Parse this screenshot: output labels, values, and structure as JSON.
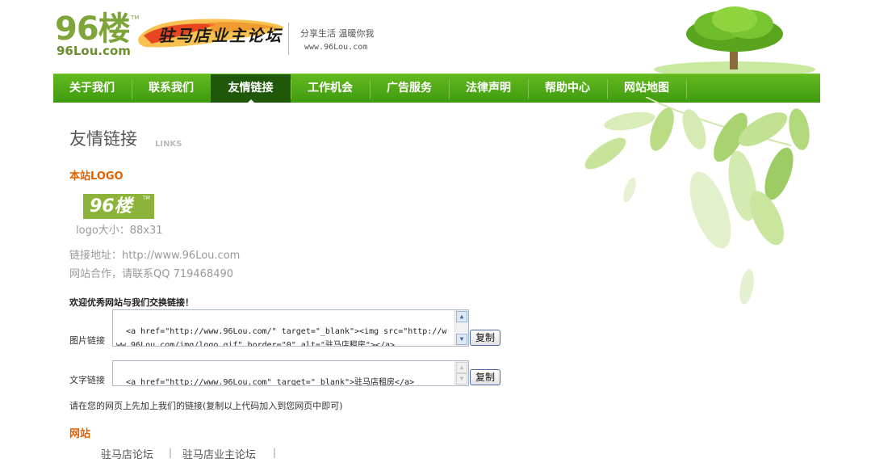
{
  "header": {
    "logo_main": "96楼",
    "logo_tm": "TM",
    "logo_domain": "96Lou.com",
    "banner_text": "驻马店业主论坛",
    "slogan": "分享生活 温暖你我",
    "url": "www.96Lou.com"
  },
  "nav": {
    "items": [
      {
        "label": "关于我们"
      },
      {
        "label": "联系我们"
      },
      {
        "label": "友情链接",
        "active": true
      },
      {
        "label": "工作机会"
      },
      {
        "label": "广告服务"
      },
      {
        "label": "法律声明"
      },
      {
        "label": "帮助中心"
      },
      {
        "label": "网站地图"
      }
    ]
  },
  "page": {
    "title": "友情链接",
    "subtitle": "LINKS"
  },
  "logo_section": {
    "heading": "本站LOGO",
    "logo_text": "96楼",
    "logo_tm": "TM",
    "logo_size": "logo大小：88x31",
    "link_address": "链接地址：http://www.96Lou.com",
    "contact": "网站合作，请联系QQ 719468490"
  },
  "exchange": {
    "heading": "欢迎优秀网站与我们交换链接！",
    "image_link_label": "图片链接",
    "image_link_code": "<a href=\"http://www.96Lou.com/\" target=\"_blank\"><img src=\"http://www.96Lou.com/img/logo.gif\" border=\"0\" alt=\"驻马店租房\"></a>",
    "text_link_label": "文字链接",
    "text_link_code": "<a href=\"http://www.96Lou.com\" target=\"_blank\">驻马店租房</a>",
    "copy_label": "复制",
    "note": "请在您的网页上先加上我们的链接(复制以上代码加入到您网页中即可)"
  },
  "sites": {
    "heading": "网站",
    "links": [
      "驻马店论坛",
      "驻马店业主论坛"
    ],
    "separator": "|"
  },
  "colors": {
    "nav_green": "#4ba716",
    "nav_active": "#20580a",
    "section_orange": "#e06100"
  }
}
